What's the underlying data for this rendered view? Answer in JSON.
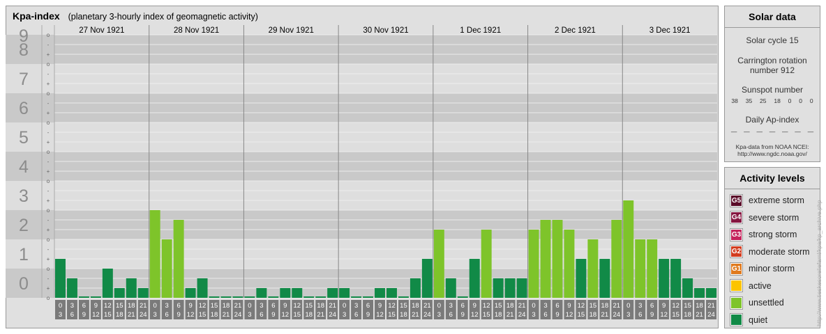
{
  "title": {
    "main": "Kpa-index",
    "subtitle": "(planetary 3-hourly index of geomagnetic activity)"
  },
  "chart_data": {
    "type": "bar",
    "title": "Kpa-index",
    "subtitle": "(planetary 3-hourly index of geomagnetic activity)",
    "ylim": [
      0,
      9
    ],
    "y_ticks": [
      "0",
      "1",
      "2",
      "3",
      "4",
      "5",
      "6",
      "7",
      "8",
      "9"
    ],
    "sub_ticks": [
      "o",
      "+",
      "-",
      "o"
    ],
    "days": [
      "27 Nov 1921",
      "28 Nov 1921",
      "29 Nov 1921",
      "30 Nov 1921",
      "1 Dec 1921",
      "2 Dec 1921",
      "3 Dec 1921"
    ],
    "interval_labels": [
      [
        "0",
        "3"
      ],
      [
        "3",
        "6"
      ],
      [
        "6",
        "9"
      ],
      [
        "9",
        "12"
      ],
      [
        "12",
        "15"
      ],
      [
        "15",
        "18"
      ],
      [
        "18",
        "21"
      ],
      [
        "21",
        "24"
      ]
    ],
    "values": [
      [
        1.333,
        0.667,
        0.0,
        0.0,
        1.0,
        0.333,
        0.667,
        0.333
      ],
      [
        3.0,
        2.0,
        2.667,
        0.333,
        0.667,
        0.0,
        0.0,
        0.0
      ],
      [
        0.0,
        0.333,
        0.0,
        0.333,
        0.333,
        0.0,
        0.0,
        0.333
      ],
      [
        0.333,
        0.0,
        0.0,
        0.333,
        0.333,
        0.0,
        0.667,
        1.333
      ],
      [
        2.333,
        0.667,
        0.0,
        1.333,
        2.333,
        0.667,
        0.667,
        0.667
      ],
      [
        2.333,
        2.667,
        2.667,
        2.333,
        1.333,
        2.0,
        1.333,
        2.667
      ],
      [
        3.333,
        2.0,
        2.0,
        1.333,
        1.333,
        0.667,
        0.333,
        0.333
      ]
    ],
    "levels": [
      {
        "name": "quiet",
        "max": 2,
        "color": "#118a47"
      },
      {
        "name": "unsettled",
        "max": 4,
        "color": "#7ec42a"
      },
      {
        "name": "active",
        "max": 5,
        "color": "#fcc400"
      },
      {
        "name": "minor storm",
        "max": 6,
        "color": "#e07a1e"
      },
      {
        "name": "moderate storm",
        "max": 7,
        "color": "#d23c1f"
      },
      {
        "name": "strong storm",
        "max": 8,
        "color": "#c4235c"
      },
      {
        "name": "severe storm",
        "max": 9,
        "color": "#851640"
      },
      {
        "name": "extreme storm",
        "max": 10,
        "color": "#5a0a28"
      }
    ],
    "grid": true
  },
  "solar": {
    "title": "Solar data",
    "cycle": "Solar cycle 15",
    "carrington_line1": "Carrington rotation",
    "carrington_line2": "number 912",
    "sunspot_title": "Sunspot number",
    "sunspots": [
      "38",
      "35",
      "25",
      "18",
      "0",
      "0",
      "0"
    ],
    "ap_title": "Daily Ap-index",
    "ap_values": [
      "—",
      "—",
      "—",
      "—",
      "—",
      "—",
      "—"
    ],
    "credit_line1": "Kpa-data from NOAA NCEI:",
    "credit_line2": "http://www.ngdc.noaa.gov/"
  },
  "activity": {
    "title": "Activity levels",
    "items": [
      {
        "code": "G5",
        "label": "extreme storm",
        "color": "#5a0a28"
      },
      {
        "code": "G4",
        "label": "severe storm",
        "color": "#851640"
      },
      {
        "code": "G3",
        "label": "strong storm",
        "color": "#c4235c"
      },
      {
        "code": "G2",
        "label": "moderate storm",
        "color": "#d23c1f"
      },
      {
        "code": "G1",
        "label": "minor storm",
        "color": "#e07a1e"
      },
      {
        "code": "",
        "label": "active",
        "color": "#fcc400"
      },
      {
        "code": "",
        "label": "unsettled",
        "color": "#7ec42a"
      },
      {
        "code": "",
        "label": "quiet",
        "color": "#118a47"
      }
    ]
  },
  "watermark": "http://www.tieskesoreliefarnl/kpa/kp_archive.php"
}
